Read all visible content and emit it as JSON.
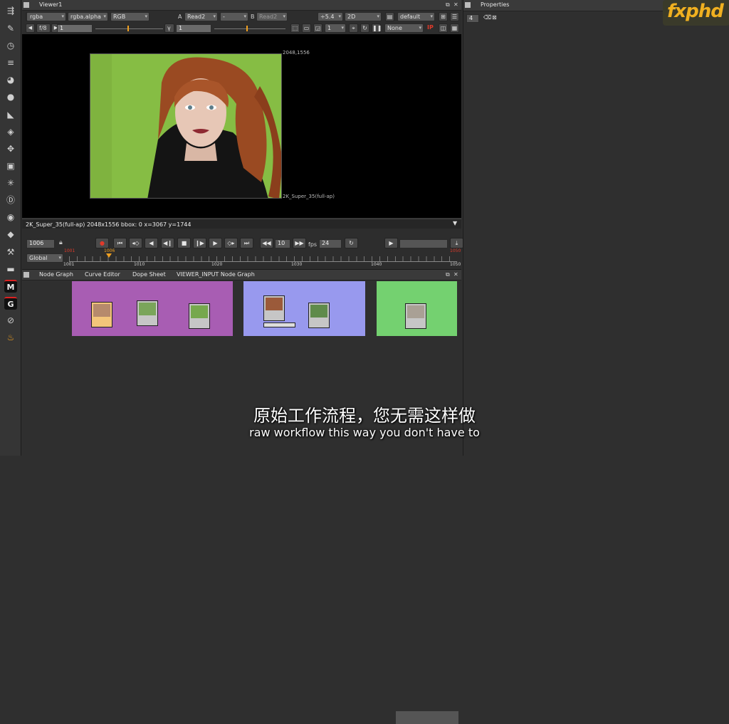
{
  "colors": {
    "bg": "#2f2f2f",
    "viewer_bg": "#000000",
    "backdrop_purple": "#a85db3",
    "backdrop_blue": "#9899ee",
    "backdrop_green": "#74d170",
    "accent_orange": "#f0a020",
    "keyframe_red": "#e03a2a"
  },
  "viewer": {
    "title": "Viewer1",
    "row1": {
      "channels": "rgba",
      "alpha": "rgba.alpha",
      "colorspace": "RGB",
      "a_label": "A",
      "a_input": "Read2",
      "blend": "-",
      "b_label": "B",
      "b_input": "Read2",
      "zoom": "÷5.4",
      "mode": "2D",
      "lut": "default"
    },
    "row2": {
      "fstop": "f/8",
      "gain": "1",
      "gamma_label": "γ",
      "gamma": "1",
      "proxy": "1",
      "roi": "None",
      "ip": "IP"
    },
    "format_top": "2048,1556",
    "format_bottom": "2K_Super_35(full-ap)",
    "info_bar": "2K_Super_35(full-ap) 2048x1556  bbox: 0  x=3067 y=1744"
  },
  "timeline": {
    "frame": "1006",
    "increment": "10",
    "fps_label": "fps",
    "fps": "24",
    "range": "Global",
    "start_marker": "1001",
    "current_marker": "1006",
    "end_marker": "1050",
    "ticks": [
      "1001",
      "1010",
      "1020",
      "1030",
      "1040",
      "1050"
    ]
  },
  "properties": {
    "title": "Properties",
    "count": "4"
  },
  "node_panel": {
    "tabs": [
      "Node Graph",
      "Curve Editor",
      "Dope Sheet",
      "VIEWER_INPUT Node Graph"
    ]
  },
  "subtitles": {
    "chinese": "原始工作流程，您无需这样做",
    "english": "raw workflow this way you don't have to"
  },
  "watermark": "fxphd",
  "icons": [
    "select-icon",
    "paint-icon",
    "time-icon",
    "channel-icon",
    "color-icon",
    "filter-icon",
    "keyer-icon",
    "merge-icon",
    "transform-icon",
    "3d-icon",
    "particles-icon",
    "deep-icon",
    "views-icon",
    "metadata-icon",
    "toolsets-icon",
    "other-icon",
    "m-plugin-icon",
    "g-plugin-icon",
    "p-plugin-icon",
    "fire-plugin-icon"
  ]
}
